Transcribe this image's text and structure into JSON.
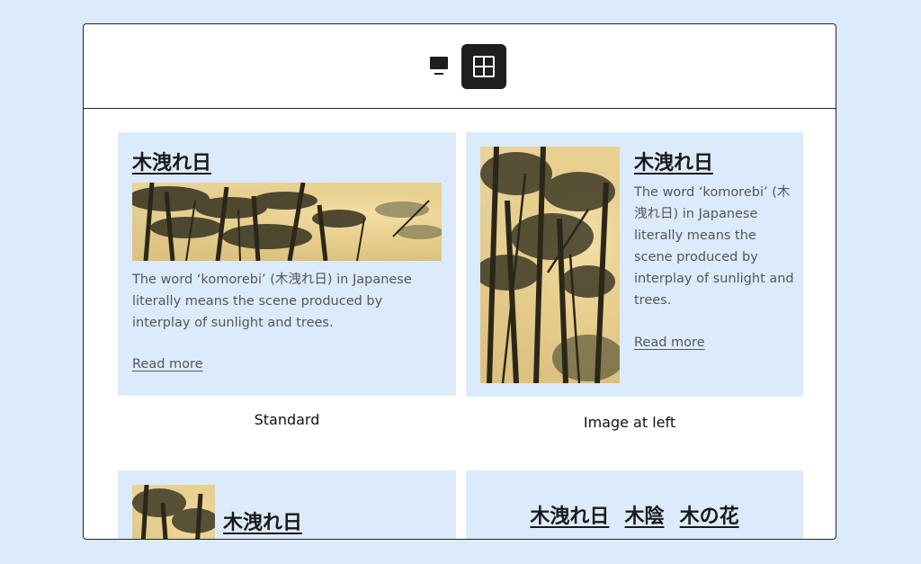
{
  "toolbar": {
    "views": [
      {
        "name": "single",
        "icon": "single-column-icon",
        "active": false
      },
      {
        "name": "grid",
        "icon": "grid-icon",
        "active": true
      }
    ],
    "active_color": "#1e1e1e"
  },
  "cards": [
    {
      "layout": "Standard",
      "title": "木洩れ日",
      "description": "The word ‘komorebi’ (木洩れ日) in Japanese literally means the scene produced by interplay of sunlight and trees.",
      "read_more": "Read more",
      "caption": "Standard"
    },
    {
      "layout": "Image at left",
      "title": "木洩れ日",
      "description": "The word ‘komorebi’ (木洩れ日) in Japanese literally means the scene produced by interplay of sunlight and trees.",
      "read_more": "Read more",
      "caption": "Image at left"
    },
    {
      "layout": "small image",
      "title": "木洩れ日"
    },
    {
      "layout": "tags",
      "tags": [
        "木洩れ日",
        "木陰",
        "木の花"
      ]
    }
  ],
  "colors": {
    "background": "#dcebfb",
    "card": "#dcebfb",
    "text": "#1a1a1a",
    "muted": "#555555"
  }
}
